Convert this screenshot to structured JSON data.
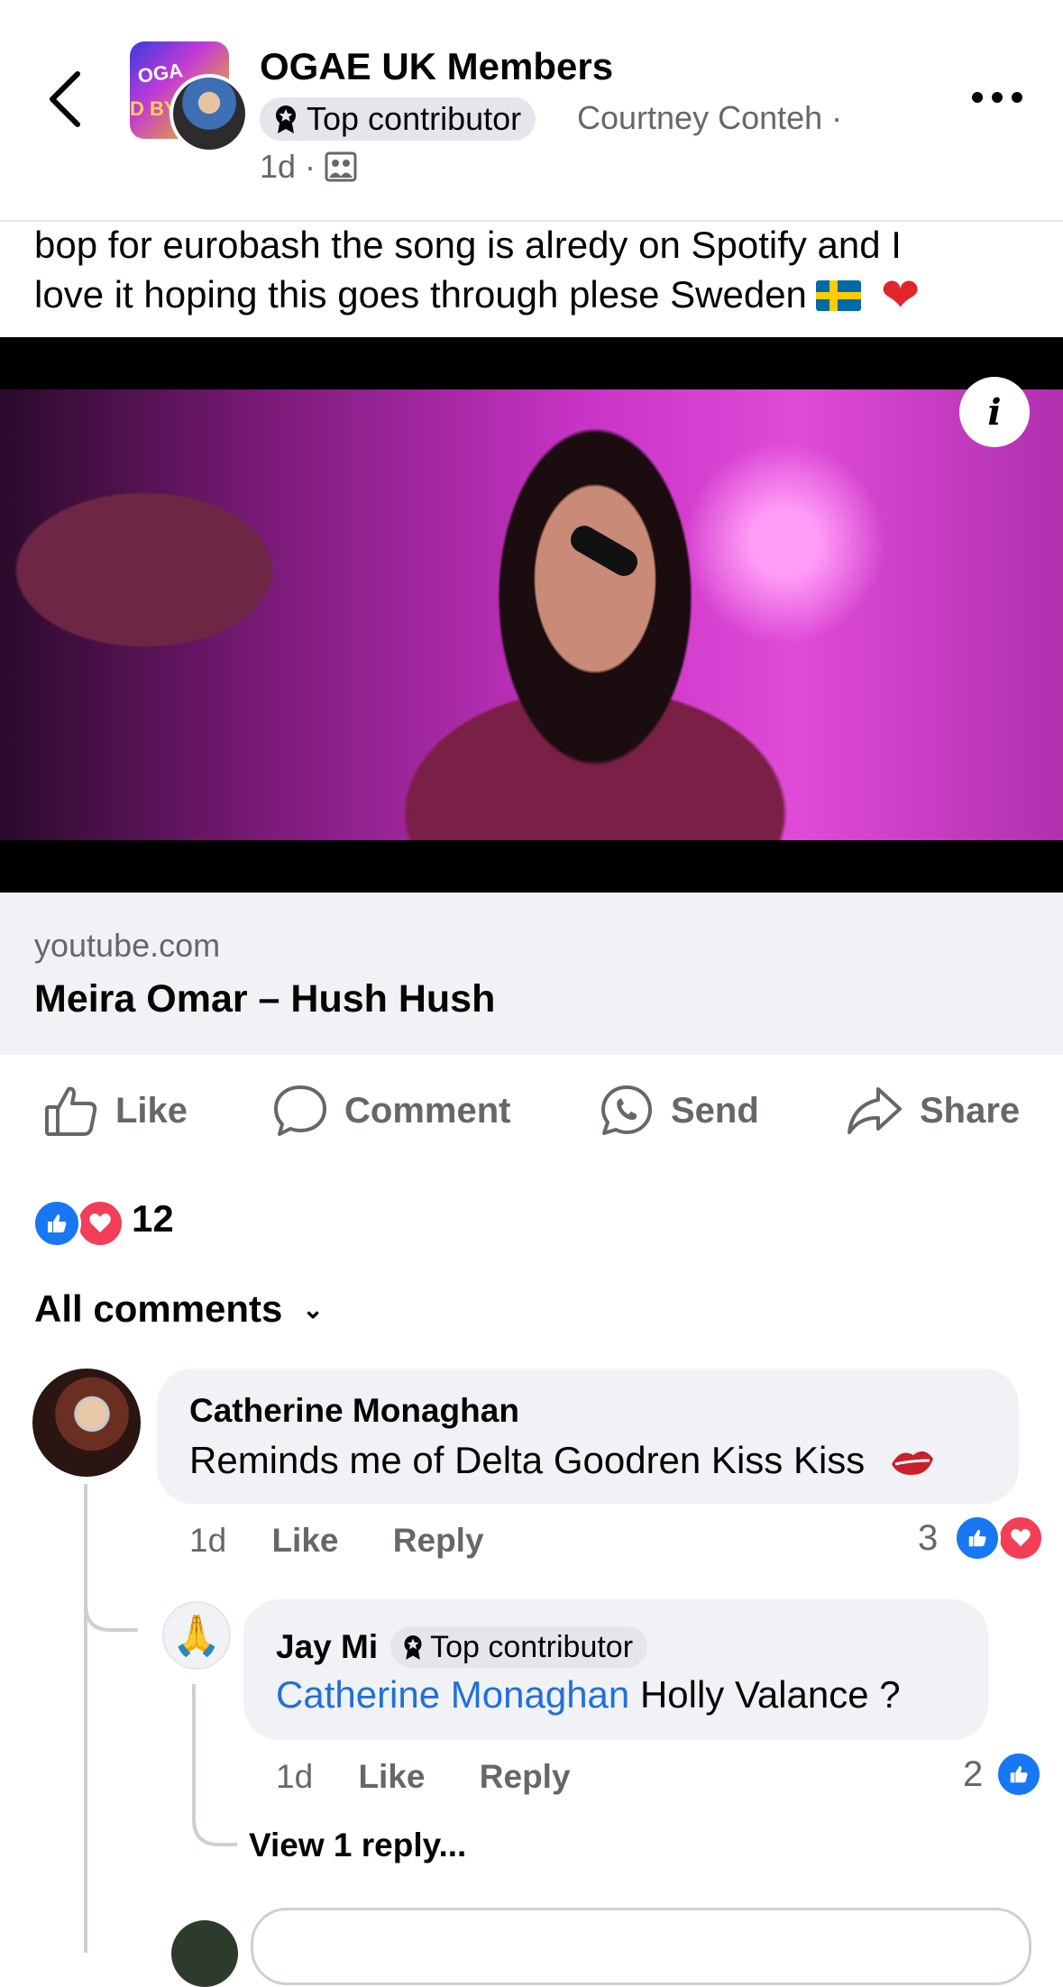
{
  "header": {
    "group_name": "OGAE UK Members",
    "badge_label": "Top contributor",
    "author": "Courtney Conteh ·",
    "time": "1d",
    "separator": "·",
    "icons": [
      "back-icon",
      "group-avatar",
      "members-group-icon",
      "more-icon"
    ]
  },
  "post": {
    "text_line1": "bop for eurobash the song is alredy on Spotify and I",
    "text_line2": "love it hoping this goes through plese Sweden",
    "emojis": [
      "sweden-flag",
      "red-heart"
    ]
  },
  "video": {
    "info_glyph": "i"
  },
  "link": {
    "domain": "youtube.com",
    "title": "Meira Omar – Hush Hush"
  },
  "actions": {
    "like": "Like",
    "comment": "Comment",
    "send": "Send",
    "share": "Share"
  },
  "reactions": {
    "count": "12",
    "types": [
      "like",
      "love"
    ]
  },
  "comments_header": {
    "label": "All comments",
    "chevron": "⌄"
  },
  "comments": [
    {
      "name": "Catherine Monaghan",
      "text": "Reminds me of Delta Goodren Kiss Kiss",
      "emoji": "kiss-mark",
      "time": "1d",
      "like": "Like",
      "reply": "Reply",
      "reaction_count": "3"
    },
    {
      "name": "Jay Mi",
      "badge": "Top contributor",
      "mention": "Catherine Monaghan",
      "text": "Holly Valance ?",
      "time": "1d",
      "like": "Like",
      "reply": "Reply",
      "reaction_count": "2",
      "avatar_emoji": "🙏"
    }
  ],
  "view_replies": "View 1 reply...",
  "colors": {
    "accent_blue": "#1877f2",
    "love_red": "#f33e58",
    "mention_blue": "#216fdb",
    "secondary_text": "#65676b",
    "bubble_bg": "#f0f2f5"
  }
}
